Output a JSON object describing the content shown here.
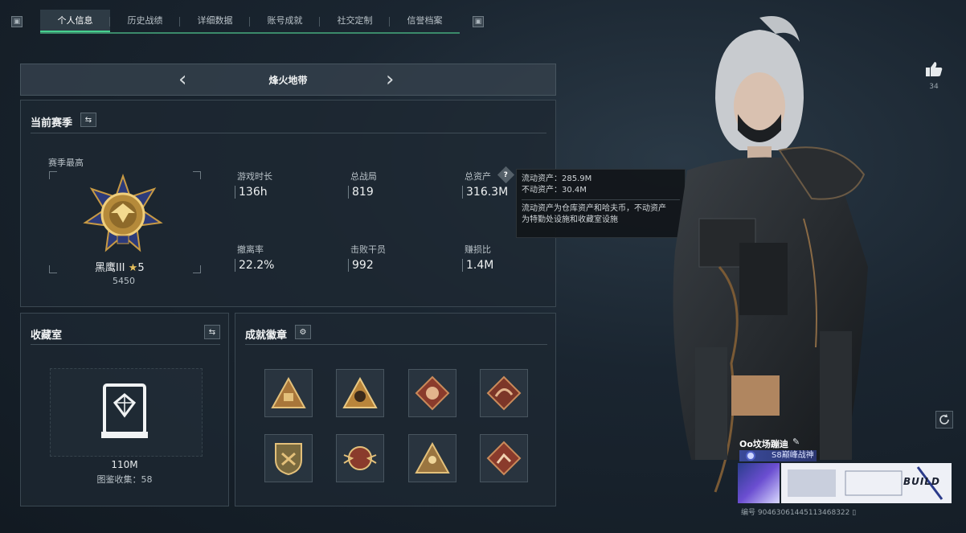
{
  "tabs": [
    {
      "label": "个人信息",
      "active": true
    },
    {
      "label": "历史战绩"
    },
    {
      "label": "详细数据"
    },
    {
      "label": "账号成就"
    },
    {
      "label": "社交定制"
    },
    {
      "label": "信誉档案"
    }
  ],
  "corner_icons": {
    "left": "▣",
    "right": "▣"
  },
  "mode": {
    "title": "烽火地带",
    "prev": "‹",
    "next": "›"
  },
  "season": {
    "title": "当前赛季",
    "highest_label": "赛季最高",
    "rank_name": "黑鹰III",
    "rank_stars": "5",
    "rank_score": "5450",
    "stats": [
      {
        "label": "游戏时长",
        "value": "136h"
      },
      {
        "label": "总战局",
        "value": "819"
      },
      {
        "label": "总资产",
        "value": "316.3M"
      },
      {
        "label": "撤离率",
        "value": "22.2%"
      },
      {
        "label": "击败干员",
        "value": "992"
      },
      {
        "label": "赚损比",
        "value": "1.4M"
      }
    ]
  },
  "tooltip": {
    "liquid": "流动资产：285.9M",
    "fixed": "不动资产：30.4M",
    "desc_line1": "流动资产为仓库资产和哈夫币，不动资产",
    "desc_line2": "为特勤处设施和收藏室设施"
  },
  "vault": {
    "title": "收藏室",
    "value": "110M",
    "collection": "图鉴收集：58"
  },
  "badges": {
    "title": "成就徽章",
    "items": [
      {
        "name": "badge-1",
        "color": "#a8763a"
      },
      {
        "name": "badge-2",
        "color": "#b9853b"
      },
      {
        "name": "badge-3",
        "color": "#8a3b2c"
      },
      {
        "name": "badge-4",
        "color": "#7c3628"
      },
      {
        "name": "badge-5",
        "color": "#7a6a3e"
      },
      {
        "name": "badge-6",
        "color": "#8a3b2c"
      },
      {
        "name": "badge-7",
        "color": "#9a7540"
      },
      {
        "name": "badge-8",
        "color": "#8a3b2c"
      }
    ]
  },
  "likes": {
    "count": "34"
  },
  "player": {
    "name": "Oo坟场蹦迪",
    "title": "S8巅峰战神",
    "card_label": "BUILD",
    "id": "编号 904630614451134​68322"
  }
}
